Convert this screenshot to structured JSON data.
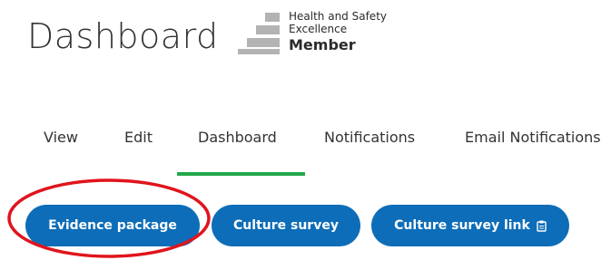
{
  "header": {
    "title": "Dashboard",
    "badge": {
      "line1": "Health and Safety",
      "line2": "Excellence",
      "line3": "Member"
    }
  },
  "tabs": [
    {
      "label": "View",
      "active": false
    },
    {
      "label": "Edit",
      "active": false
    },
    {
      "label": "Dashboard",
      "active": true
    },
    {
      "label": "Notifications",
      "active": false
    },
    {
      "label": "Email Notifications",
      "active": false
    }
  ],
  "buttons": {
    "evidence_package": "Evidence package",
    "culture_survey": "Culture survey",
    "culture_survey_link": "Culture survey link",
    "culture_survey_link_icon": "clipboard-icon"
  },
  "colors": {
    "accent_green": "#22a84a",
    "button_blue": "#0d6db8",
    "annotation_red": "#e0141c"
  }
}
